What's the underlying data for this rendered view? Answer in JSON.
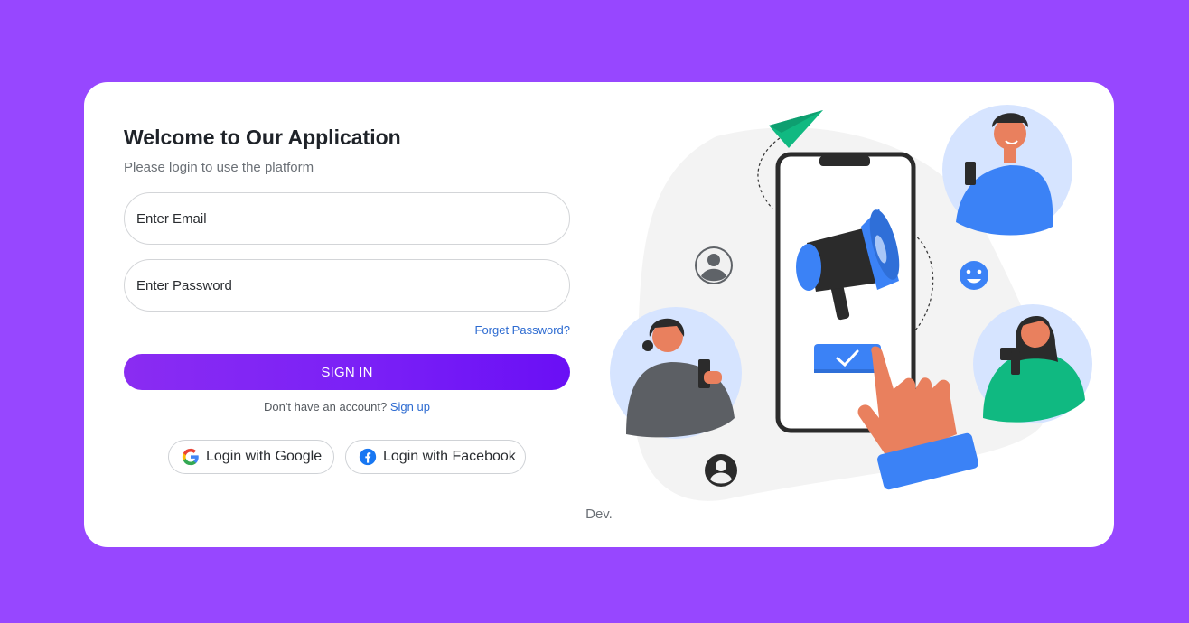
{
  "heading": {
    "title": "Welcome to Our Application",
    "subtitle": "Please login to use the platform"
  },
  "form": {
    "email_placeholder": "Enter Email",
    "password_placeholder": "Enter Password",
    "forgot_label": "Forget Password?",
    "signin_label": "SIGN IN",
    "signup_prompt": "Don't have an account?",
    "signup_link": "Sign up"
  },
  "social": {
    "google_label": "Login with Google",
    "facebook_label": "Login with Facebook"
  },
  "footer": {
    "credit": "Dev."
  },
  "colors": {
    "background": "#9747ff",
    "accent": "#7a20f6",
    "link": "#2d6bd1",
    "illustration_blue": "#3b82f6",
    "illustration_green": "#10b981"
  },
  "icons": [
    "google-icon",
    "facebook-icon",
    "paper-plane-icon",
    "megaphone-icon",
    "checkmark-icon",
    "user-icon",
    "smiley-icon"
  ]
}
